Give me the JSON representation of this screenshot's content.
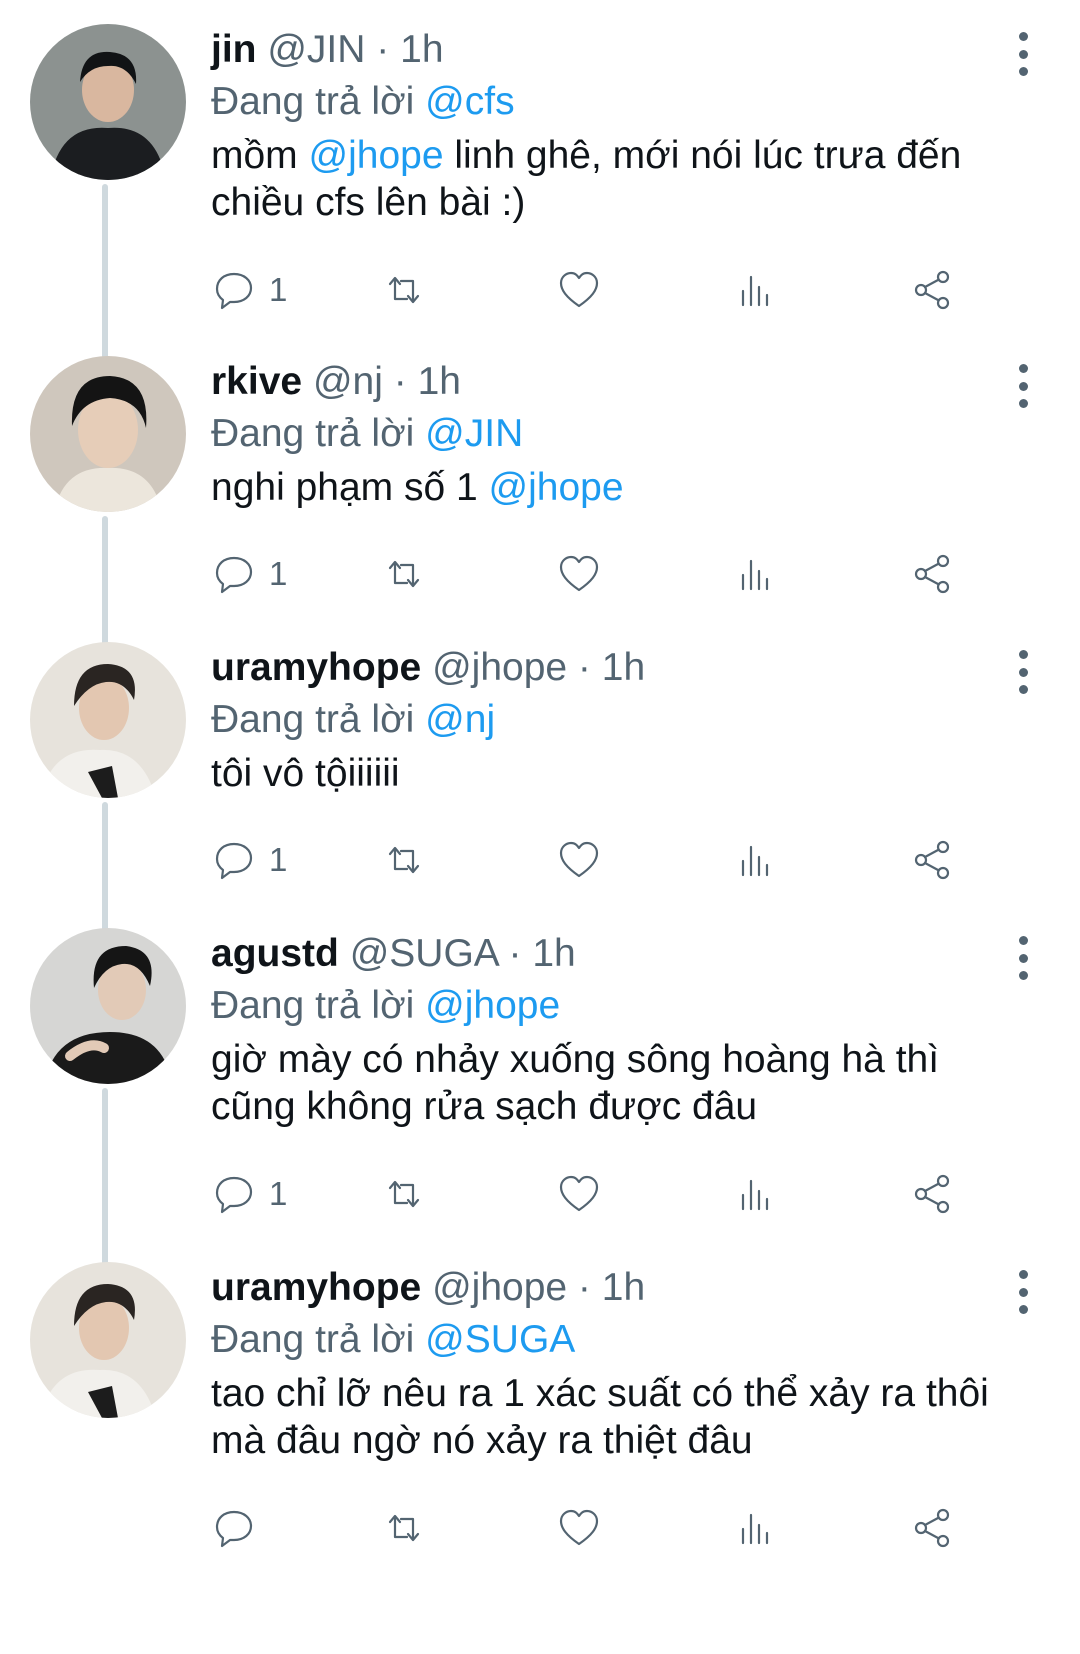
{
  "tweets": [
    {
      "name": "jin",
      "handle": "@JIN",
      "sep": "·",
      "time": "1h",
      "reply_prefix": "Đang trả lời",
      "reply_to": "@cfs",
      "text_before": "mồm ",
      "text_mention": "@jhope",
      "text_after": " linh ghê, mới nói lúc trưa đến\nchiều cfs lên bài :)",
      "reply_count": "1",
      "avatar_colors": {
        "bg": "#8c9290",
        "hair": "#111315",
        "skin": "#d9b79f",
        "shirt": "#1b1d20"
      }
    },
    {
      "name": "rkive",
      "handle": "@nj",
      "sep": "·",
      "time": "1h",
      "reply_prefix": "Đang trả lời",
      "reply_to": "@JIN",
      "text_before": "nghi phạm số 1 ",
      "text_mention": "@jhope",
      "text_after": "",
      "reply_count": "1",
      "avatar_colors": {
        "bg": "#cfc7bd",
        "hair": "#141414",
        "skin": "#e6cdb8",
        "shirt": "#ece6dc"
      }
    },
    {
      "name": "uramyhope",
      "handle": "@jhope",
      "sep": "·",
      "time": "1h",
      "reply_prefix": "Đang trả lời",
      "reply_to": "@nj",
      "text_before": "tôi vô tộiiiiii",
      "text_mention": "",
      "text_after": "",
      "reply_count": "1",
      "avatar_colors": {
        "bg": "#e7e3dc",
        "hair": "#2a2522",
        "skin": "#e3c7b1",
        "shirt": "#f2f0ec"
      }
    },
    {
      "name": "agustd",
      "handle": "@SUGA",
      "sep": "·",
      "time": "1h",
      "reply_prefix": "Đang trả lời",
      "reply_to": "@jhope",
      "text_before": "giờ mày có nhảy xuống sông hoàng hà thì\ncũng không rửa sạch được đâu",
      "text_mention": "",
      "text_after": "",
      "reply_count": "1",
      "avatar_colors": {
        "bg": "#d6d6d4",
        "hair": "#151515",
        "skin": "#e2cab7",
        "shirt": "#1a1a1a"
      }
    },
    {
      "name": "uramyhope",
      "handle": "@jhope",
      "sep": "·",
      "time": "1h",
      "reply_prefix": "Đang trả lời",
      "reply_to": "@SUGA",
      "text_before": "tao chỉ lỡ nêu ra 1 xác suất có thể xảy ra thôi\nmà đâu ngờ nó xảy ra thiệt đâu",
      "text_mention": "",
      "text_after": "",
      "reply_count": "",
      "avatar_colors": {
        "bg": "#e7e3dc",
        "hair": "#2a2522",
        "skin": "#e3c7b1",
        "shirt": "#f2f0ec"
      }
    }
  ],
  "icons": [
    "reply-icon",
    "retweet-icon",
    "like-icon",
    "views-icon",
    "share-icon",
    "more-options-icon"
  ],
  "colors": {
    "link": "#1d9bf0",
    "secondary_text": "#536471",
    "thread_line": "#cfd9de"
  }
}
